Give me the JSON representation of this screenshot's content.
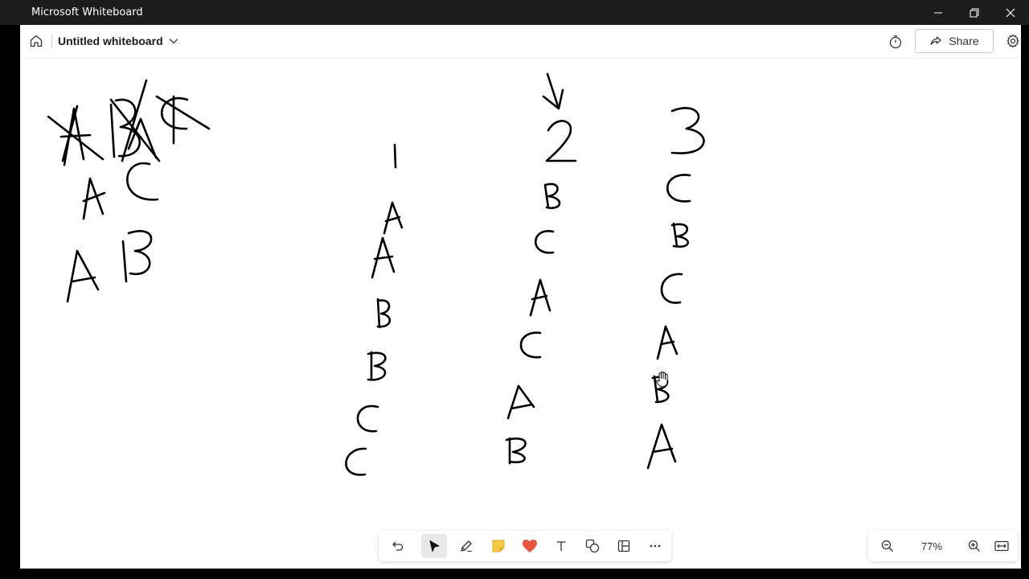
{
  "window": {
    "title": "Microsoft Whiteboard"
  },
  "header": {
    "board_title": "Untitled whiteboard",
    "share_label": "Share"
  },
  "zoom": {
    "level": "77%"
  },
  "toolbar": {
    "tools": [
      "undo-icon",
      "select-icon",
      "pen-icon",
      "sticky-note-icon",
      "reaction-icon",
      "text-icon",
      "shapes-icon",
      "templates-icon",
      "more-icon"
    ],
    "active_tool": "select-icon"
  },
  "canvas": {
    "ink_color": "#000000",
    "left_cluster": [
      "A",
      "B",
      "C",
      "A",
      "C",
      "A",
      "B"
    ],
    "columns": [
      {
        "header": "1",
        "letters": [
          "A",
          "A",
          "B",
          "B",
          "C",
          "C"
        ]
      },
      {
        "header": "2",
        "letters": [
          "B",
          "C",
          "A",
          "C",
          "A",
          "B"
        ]
      },
      {
        "header": "3",
        "letters": [
          "C",
          "B",
          "C",
          "A",
          "B",
          "A"
        ]
      }
    ]
  },
  "colors": {
    "titlebar_bg": "#1c1c1c",
    "canvas_bg": "#ffffff",
    "sticky_note": "#f7c948",
    "reaction_heart": "#e8553e"
  }
}
